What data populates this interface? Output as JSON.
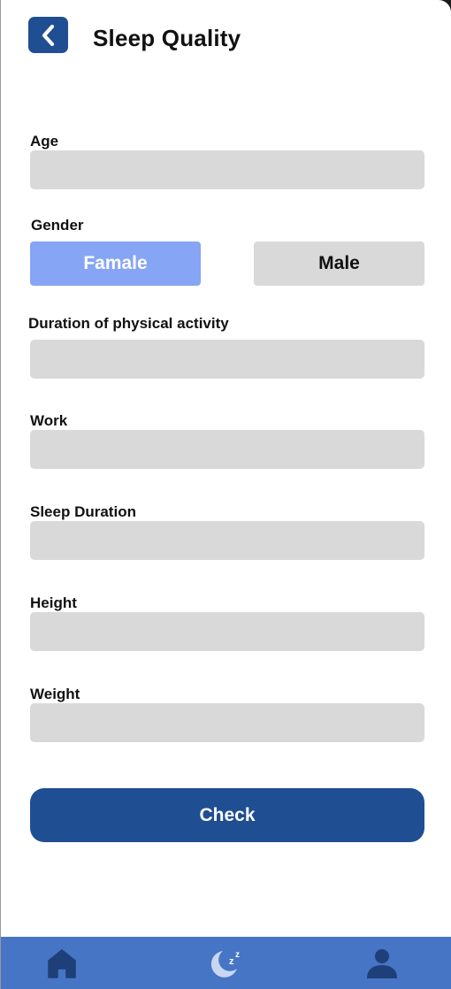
{
  "header": {
    "title": "Sleep Quality",
    "back_icon": "chevron-left-icon"
  },
  "form": {
    "age_label": "Age",
    "age_value": "",
    "gender_label": "Gender",
    "gender_options": [
      "Famale",
      "Male"
    ],
    "gender_selected": "Famale",
    "activity_label": "Duration of physical activity",
    "activity_value": "",
    "work_label": "Work",
    "work_value": "",
    "sleep_duration_label": "Sleep Duration",
    "sleep_duration_value": "",
    "height_label": "Height",
    "height_value": "",
    "weight_label": "Weight",
    "weight_value": "",
    "submit_label": "Check"
  },
  "nav": {
    "items": [
      {
        "icon": "home-icon"
      },
      {
        "icon": "sleep-moon-icon"
      },
      {
        "icon": "profile-icon"
      }
    ]
  },
  "colors": {
    "primary": "#1f4e93",
    "selected_option": "#86a5f4",
    "field_bg": "#d9d9d9",
    "nav_bg": "#4575c4"
  }
}
